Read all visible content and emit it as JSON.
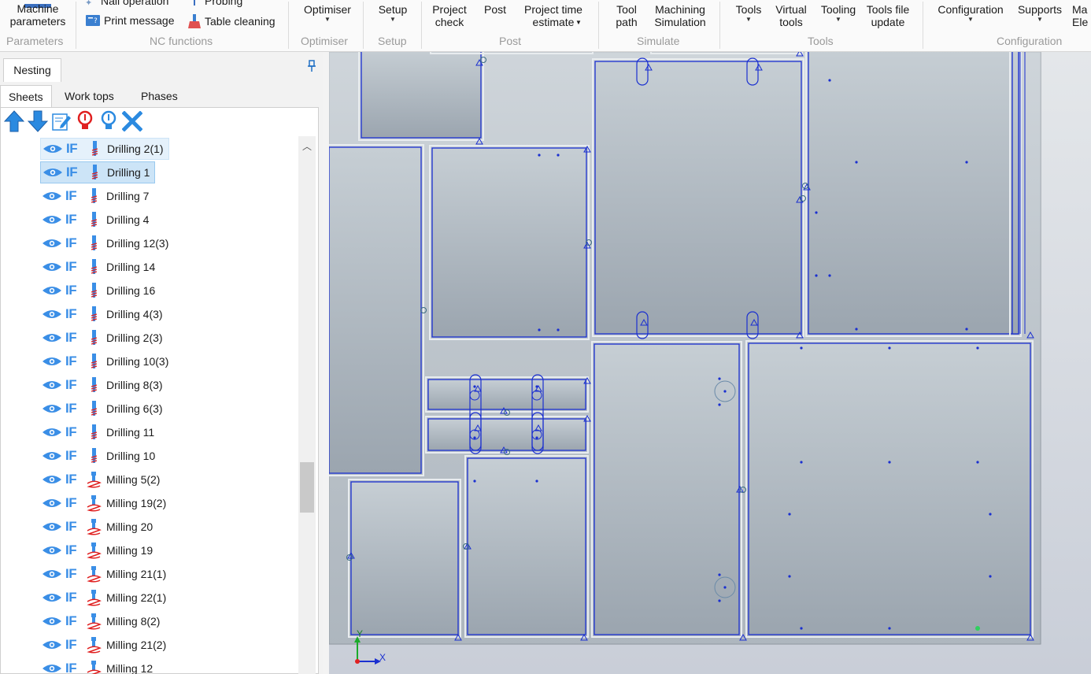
{
  "ribbon": {
    "machine_parameters": "Machine parameters",
    "nail_operation": "Nail operation",
    "probing": "Probing",
    "print_message": "Print message",
    "table_cleaning": "Table cleaning",
    "optimiser": "Optimiser",
    "setup": "Setup",
    "project_check": "Project check",
    "post": "Post",
    "project_time_estimate": "Project time estimate",
    "tool_path": "Tool path",
    "machining_simulation": "Machining Simulation",
    "tools": "Tools",
    "virtual_tools": "Virtual tools",
    "tooling": "Tooling",
    "tools_file_update": "Tools file update",
    "configuration": "Configuration",
    "supports": "Supports",
    "ma_ele": "Ma Ele",
    "groups": {
      "parameters": "Parameters",
      "nc_functions": "NC functions",
      "optimiser": "Optimiser",
      "setup": "Setup",
      "post": "Post",
      "simulate": "Simulate",
      "tools": "Tools",
      "configuration": "Configuration"
    }
  },
  "panel": {
    "title": "Nesting",
    "tabs": [
      "Sheets",
      "Work tops",
      "Phases"
    ],
    "active_tab": "Sheets",
    "condition_label": "IF",
    "rows": [
      {
        "label": "Drilling 2(1)",
        "kind": "drill",
        "state": "hover"
      },
      {
        "label": "Drilling 1",
        "kind": "drill",
        "state": "selected"
      },
      {
        "label": "Drilling 7",
        "kind": "drill",
        "state": ""
      },
      {
        "label": "Drilling 4",
        "kind": "drill",
        "state": ""
      },
      {
        "label": "Drilling 12(3)",
        "kind": "drill",
        "state": ""
      },
      {
        "label": "Drilling 14",
        "kind": "drill",
        "state": ""
      },
      {
        "label": "Drilling 16",
        "kind": "drill",
        "state": ""
      },
      {
        "label": "Drilling 4(3)",
        "kind": "drill",
        "state": ""
      },
      {
        "label": "Drilling 2(3)",
        "kind": "drill",
        "state": ""
      },
      {
        "label": "Drilling 10(3)",
        "kind": "drill",
        "state": ""
      },
      {
        "label": "Drilling 8(3)",
        "kind": "drill",
        "state": ""
      },
      {
        "label": "Drilling 6(3)",
        "kind": "drill",
        "state": ""
      },
      {
        "label": "Drilling 11",
        "kind": "drill",
        "state": ""
      },
      {
        "label": "Drilling 10",
        "kind": "drill",
        "state": ""
      },
      {
        "label": "Milling 5(2)",
        "kind": "mill",
        "state": ""
      },
      {
        "label": "Milling 19(2)",
        "kind": "mill",
        "state": ""
      },
      {
        "label": "Milling 20",
        "kind": "mill",
        "state": ""
      },
      {
        "label": "Milling 19",
        "kind": "mill",
        "state": ""
      },
      {
        "label": "Milling 21(1)",
        "kind": "mill",
        "state": ""
      },
      {
        "label": "Milling 22(1)",
        "kind": "mill",
        "state": ""
      },
      {
        "label": "Milling 8(2)",
        "kind": "mill",
        "state": ""
      },
      {
        "label": "Milling 21(2)",
        "kind": "mill",
        "state": ""
      },
      {
        "label": "Milling 12",
        "kind": "mill",
        "state": ""
      }
    ]
  },
  "canvas": {
    "axis_x": "X",
    "axis_y": "Y",
    "colors": {
      "part_fill": "#aeb6bf",
      "contour": "#1a2fd0",
      "sheet_fill": "#c2c9cf"
    }
  }
}
